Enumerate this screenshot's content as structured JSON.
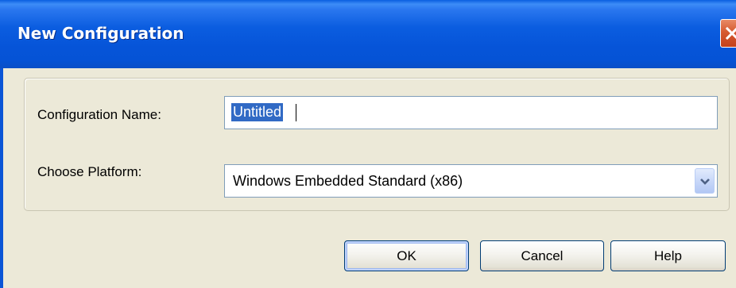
{
  "window": {
    "title": "New Configuration"
  },
  "form": {
    "name_label": "Configuration Name:",
    "name_value": "Untitled",
    "platform_label": "Choose Platform:",
    "platform_value": "Windows Embedded Standard (x86)"
  },
  "buttons": {
    "ok": "OK",
    "cancel": "Cancel",
    "help": "Help"
  },
  "icons": {
    "close": "close-icon",
    "dropdown": "chevron-down-icon"
  },
  "colors": {
    "titlebar": "#0b5de0",
    "dialog_bg": "#ece9d8",
    "selection": "#316ac5",
    "close_button": "#d65a30"
  }
}
